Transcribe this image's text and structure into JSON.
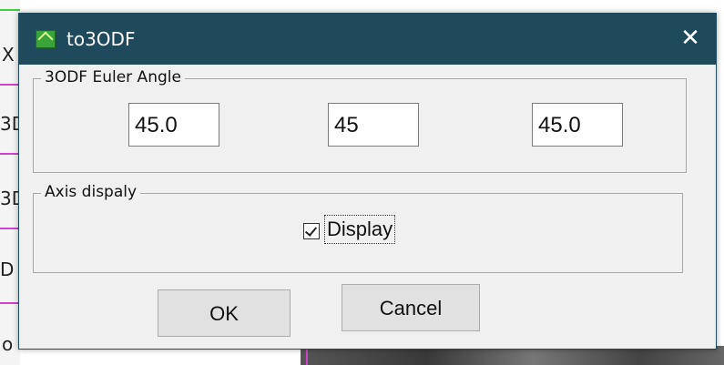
{
  "background": {
    "left_glyphs": [
      "X",
      "3D",
      "3D",
      "D",
      "o"
    ]
  },
  "dialog": {
    "title": "to3ODF",
    "close_label": "✕",
    "euler_group": {
      "label": "3ODF Euler Angle",
      "values": [
        "45.0",
        "45",
        "45.0"
      ]
    },
    "axis_group": {
      "label": "Axis dispaly",
      "checkbox_label": "Display",
      "checked": true
    },
    "buttons": {
      "ok": "OK",
      "cancel": "Cancel"
    }
  },
  "colors": {
    "titlebar": "#1f4a5c",
    "dialog_bg": "#f0f0f0",
    "button_bg": "#e1e1e1",
    "accent_magenta": "#cc44cc",
    "accent_green": "#44cc44"
  }
}
